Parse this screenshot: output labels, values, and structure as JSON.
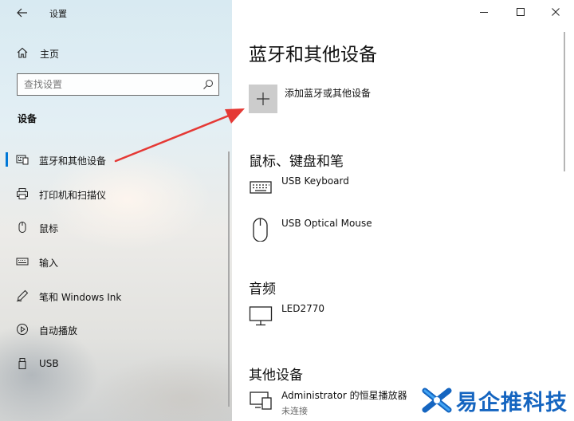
{
  "window": {
    "title": "设置",
    "controls": {
      "minimize": "minimize",
      "maximize": "maximize",
      "close": "close"
    }
  },
  "sidebar": {
    "home_label": "主页",
    "search": {
      "placeholder": "查找设置",
      "value": ""
    },
    "section_header": "设备",
    "items": [
      {
        "label": "蓝牙和其他设备",
        "icon": "keyboard-devices-icon",
        "selected": true
      },
      {
        "label": "打印机和扫描仪",
        "icon": "printer-icon",
        "selected": false
      },
      {
        "label": "鼠标",
        "icon": "mouse-icon",
        "selected": false
      },
      {
        "label": "输入",
        "icon": "keyboard-icon",
        "selected": false
      },
      {
        "label": "笔和 Windows Ink",
        "icon": "pen-icon",
        "selected": false
      },
      {
        "label": "自动播放",
        "icon": "autoplay-icon",
        "selected": false
      },
      {
        "label": "USB",
        "icon": "usb-icon",
        "selected": false
      }
    ]
  },
  "main": {
    "title": "蓝牙和其他设备",
    "add_device_label": "添加蓝牙或其他设备",
    "groups": [
      {
        "title": "鼠标、键盘和笔",
        "devices": [
          {
            "name": "USB Keyboard",
            "status": "",
            "icon": "keyboard-icon"
          },
          {
            "name": "USB Optical Mouse",
            "status": "",
            "icon": "mouse-icon"
          }
        ]
      },
      {
        "title": "音频",
        "devices": [
          {
            "name": "LED2770",
            "status": "",
            "icon": "monitor-icon"
          }
        ]
      },
      {
        "title": "其他设备",
        "devices": [
          {
            "name": "Administrator 的恒星播放器",
            "status": "未连接",
            "icon": "media-device-icon"
          }
        ]
      }
    ]
  },
  "watermark": {
    "text": "易企推科技"
  },
  "colors": {
    "accent": "#0078d7",
    "annotation_arrow": "#e53935",
    "watermark": "#1565c0"
  }
}
